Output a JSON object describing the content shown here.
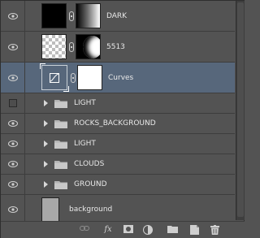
{
  "layers_panel": {
    "layers": [
      {
        "name": "DARK",
        "type": "pixel",
        "visible": true
      },
      {
        "name": "5513",
        "type": "pixel",
        "visible": true
      },
      {
        "name": "Curves",
        "type": "adjustment",
        "visible": true,
        "selected": true
      },
      {
        "name": "LIGHT",
        "type": "group",
        "visible": false
      },
      {
        "name": "ROCKS_BACKGROUND",
        "type": "group",
        "visible": true
      },
      {
        "name": "LIGHT",
        "type": "group",
        "visible": true
      },
      {
        "name": "CLOUDS",
        "type": "group",
        "visible": true
      },
      {
        "name": "GROUND",
        "type": "group",
        "visible": true
      },
      {
        "name": "background",
        "type": "background",
        "visible": true
      }
    ],
    "toolbar": {
      "icons": [
        "link-layers-icon",
        "fx-icon",
        "add-mask-icon",
        "adjustment-icon",
        "new-group-icon",
        "new-layer-icon",
        "trash-icon"
      ],
      "fx_label": "fx"
    }
  },
  "colors": {
    "panel_bg": "#535353",
    "selected_row": "#57677b",
    "divider": "#3d3d3d"
  }
}
